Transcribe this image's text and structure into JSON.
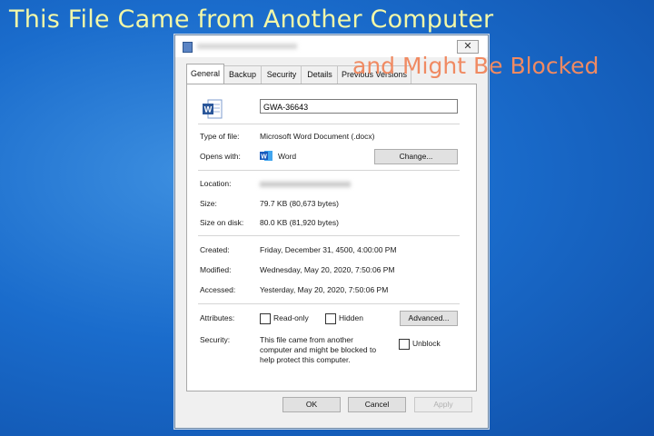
{
  "banner": {
    "title": "This File Came from Another Computer",
    "subtitle": "and Might Be Blocked"
  },
  "dialog": {
    "close_glyph": "✕",
    "tabs": [
      {
        "label": "General",
        "active": true
      },
      {
        "label": "Backup"
      },
      {
        "label": "Security"
      },
      {
        "label": "Details"
      },
      {
        "label": "Previous Versions"
      }
    ],
    "file_icon": "word-document-icon",
    "file_name": "GWA-36643",
    "type_label": "Type of file:",
    "type_value": "Microsoft Word Document (.docx)",
    "opens_label": "Opens with:",
    "opens_icon": "word-app-icon",
    "opens_value": "Word",
    "change_button": "Change...",
    "location_label": "Location:",
    "size_label": "Size:",
    "size_value": "79.7 KB (80,673 bytes)",
    "size_disk_label": "Size on disk:",
    "size_disk_value": "80.0 KB (81,920 bytes)",
    "created_label": "Created:",
    "created_value": "Friday, December 31, 4500, 4:00:00 PM",
    "modified_label": "Modified:",
    "modified_value": "Wednesday, May 20, 2020, 7:50:06 PM",
    "accessed_label": "Accessed:",
    "accessed_value": "Yesterday, May 20, 2020, 7:50:06 PM",
    "attributes_label": "Attributes:",
    "readonly_label": "Read-only",
    "hidden_label": "Hidden",
    "advanced_button": "Advanced...",
    "security_label": "Security:",
    "security_text_1": "This file came from another",
    "security_text_2": "computer and might be blocked to",
    "security_text_3": "help protect this computer.",
    "unblock_label": "Unblock",
    "ok_button": "OK",
    "cancel_button": "Cancel",
    "apply_button": "Apply",
    "accent_color": "#2b579a"
  }
}
